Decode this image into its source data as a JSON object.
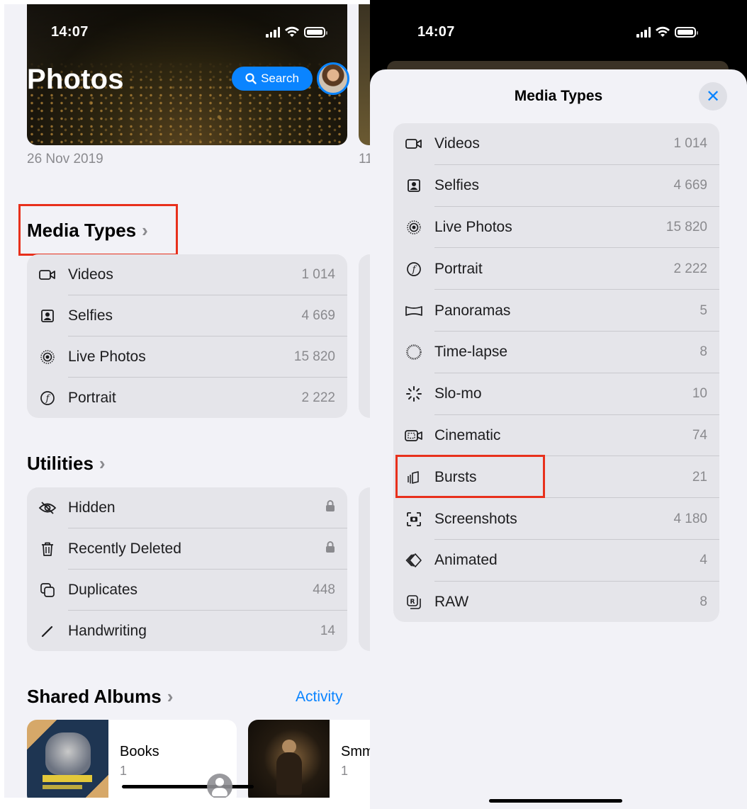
{
  "left": {
    "status": {
      "time": "14:07"
    },
    "title": "Photos",
    "search_label": "Search",
    "dates": [
      "26 Nov 2019",
      "11"
    ],
    "media_types": {
      "title": "Media Types",
      "items": [
        {
          "icon": "video-camera-icon",
          "label": "Videos",
          "count": "1 014"
        },
        {
          "icon": "selfie-portrait-icon",
          "label": "Selfies",
          "count": "4 669"
        },
        {
          "icon": "live-photo-icon",
          "label": "Live Photos",
          "count": "15 820"
        },
        {
          "icon": "portrait-aperture-icon",
          "label": "Portrait",
          "count": "2 222"
        }
      ]
    },
    "utilities": {
      "title": "Utilities",
      "items": [
        {
          "icon": "eye-slash-icon",
          "label": "Hidden",
          "count": ""
        },
        {
          "icon": "trash-icon",
          "label": "Recently Deleted",
          "count": ""
        },
        {
          "icon": "duplicate-icon",
          "label": "Duplicates",
          "count": "448"
        },
        {
          "icon": "pencil-icon",
          "label": "Handwriting",
          "count": "14"
        }
      ]
    },
    "shared_albums": {
      "title": "Shared Albums",
      "activity_label": "Activity",
      "albums": [
        {
          "name": "Books",
          "count": "1"
        },
        {
          "name": "Smm",
          "count": "1"
        }
      ]
    }
  },
  "right": {
    "status": {
      "time": "14:07"
    },
    "sheet_title": "Media Types",
    "items": [
      {
        "icon": "video-camera-icon",
        "label": "Videos",
        "count": "1 014"
      },
      {
        "icon": "selfie-portrait-icon",
        "label": "Selfies",
        "count": "4 669"
      },
      {
        "icon": "live-photo-icon",
        "label": "Live Photos",
        "count": "15 820"
      },
      {
        "icon": "portrait-aperture-icon",
        "label": "Portrait",
        "count": "2 222"
      },
      {
        "icon": "panorama-icon",
        "label": "Panoramas",
        "count": "5"
      },
      {
        "icon": "time-lapse-icon",
        "label": "Time-lapse",
        "count": "8"
      },
      {
        "icon": "slo-mo-icon",
        "label": "Slo-mo",
        "count": "10"
      },
      {
        "icon": "cinematic-icon",
        "label": "Cinematic",
        "count": "74"
      },
      {
        "icon": "bursts-icon",
        "label": "Bursts",
        "count": "21"
      },
      {
        "icon": "screenshot-icon",
        "label": "Screenshots",
        "count": "4 180"
      },
      {
        "icon": "animated-icon",
        "label": "Animated",
        "count": "4"
      },
      {
        "icon": "raw-icon",
        "label": "RAW",
        "count": "8"
      }
    ]
  },
  "colors": {
    "accent": "#0a84ff",
    "highlight": "#e8301c",
    "card": "#e5e5ea",
    "background": "#f2f2f7"
  }
}
